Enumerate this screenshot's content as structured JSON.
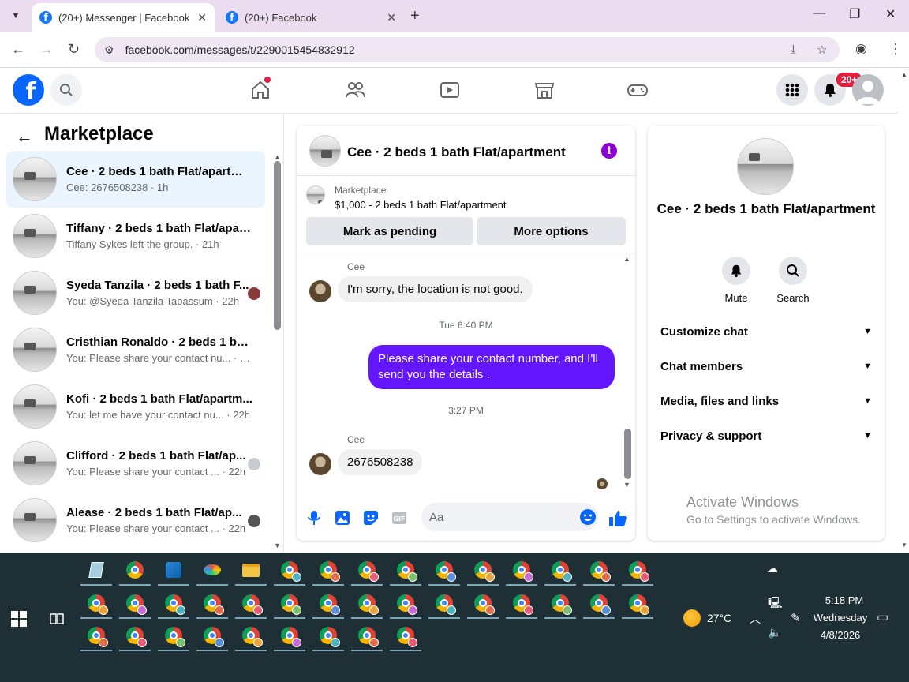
{
  "browser": {
    "tabs": [
      {
        "title": "(20+) Messenger | Facebook",
        "active": true
      },
      {
        "title": "(20+) Facebook",
        "active": false
      }
    ],
    "url": "facebook.com/messages/t/2290015454832912"
  },
  "facebook": {
    "notification_badge": "20+"
  },
  "left_panel": {
    "title": "Marketplace",
    "conversations": [
      {
        "name": "Cee · 2 beds 1 bath Flat/apartme...",
        "sub": "Cee: 2676508238 · 1h",
        "selected": true
      },
      {
        "name": "Tiffany · 2 beds 1 bath Flat/apart...",
        "sub": "Tiffany Sykes left the group. · 21h"
      },
      {
        "name": "Syeda Tanzila · 2 beds 1 bath F...",
        "sub": "You: @Syeda Tanzila Tabassum · 22h"
      },
      {
        "name": "Cristhian Ronaldo · 2 beds 1 bat...",
        "sub": "You: Please share your contact nu...  · 22h"
      },
      {
        "name": "Kofi · 2 beds 1 bath Flat/apartm...",
        "sub": "You: let me have your contact nu...  · 22h"
      },
      {
        "name": "Clifford · 2 beds 1 bath Flat/ap...",
        "sub": "You: Please share your contact ...  · 22h"
      },
      {
        "name": "Alease · 2 beds 1 bath Flat/ap...",
        "sub": "You: Please share your contact ...  · 22h"
      }
    ]
  },
  "chat": {
    "title": "Cee · 2 beds 1 bath Flat/apartment",
    "marketplace_label": "Marketplace",
    "listing": "$1,000 - 2 beds 1 bath Flat/apartment",
    "mark_pending": "Mark as pending",
    "more_options": "More options",
    "messages": {
      "m1_sender": "Cee",
      "m1_text": "I'm sorry, the location is not good.",
      "ts1": "Tue 6:40 PM",
      "m2_text": "Please share your contact number, and I'll send you the details .",
      "ts2": "3:27 PM",
      "m3_sender": "Cee",
      "m3_text": "2676508238"
    },
    "composer_placeholder": "Aa"
  },
  "info_panel": {
    "title": "Cee · 2 beds 1 bath Flat/apartment",
    "mute": "Mute",
    "search": "Search",
    "sections": [
      "Customize chat",
      "Chat members",
      "Media, files and links",
      "Privacy & support"
    ]
  },
  "watermark": {
    "line1": "Activate Windows",
    "line2": "Go to Settings to activate Windows."
  },
  "taskbar": {
    "temperature": "27°C",
    "time": "5:18 PM",
    "day": "Wednesday",
    "date": "4/8/2026"
  }
}
